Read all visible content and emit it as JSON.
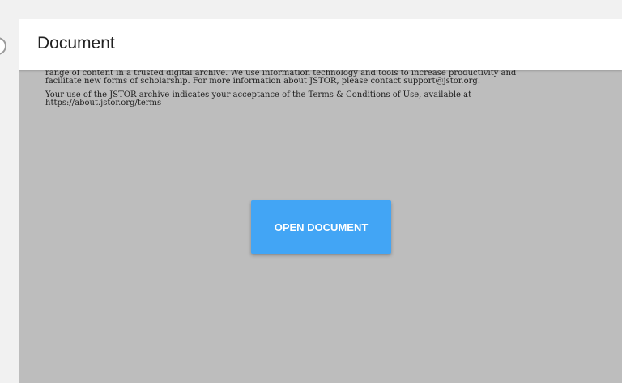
{
  "header": {
    "title": "Document"
  },
  "document_preview": {
    "paragraph_1": [
      "range of content in a trusted digital archive. We use information technology and tools to increase productivity and",
      "facilitate new forms of scholarship. For more information about JSTOR, please contact support@jstor.org."
    ],
    "paragraph_2": [
      "Your use of the JSTOR archive indicates your acceptance of the Terms & Conditions of Use, available at",
      "https://about.jstor.org/terms"
    ]
  },
  "actions": {
    "open_document_label": "OPEN DOCUMENT"
  },
  "colors": {
    "page_background": "#f1f1f1",
    "card_background": "#bdbdbd",
    "header_background": "#ffffff",
    "button_background": "#42a5f5",
    "button_text": "#ffffff"
  }
}
